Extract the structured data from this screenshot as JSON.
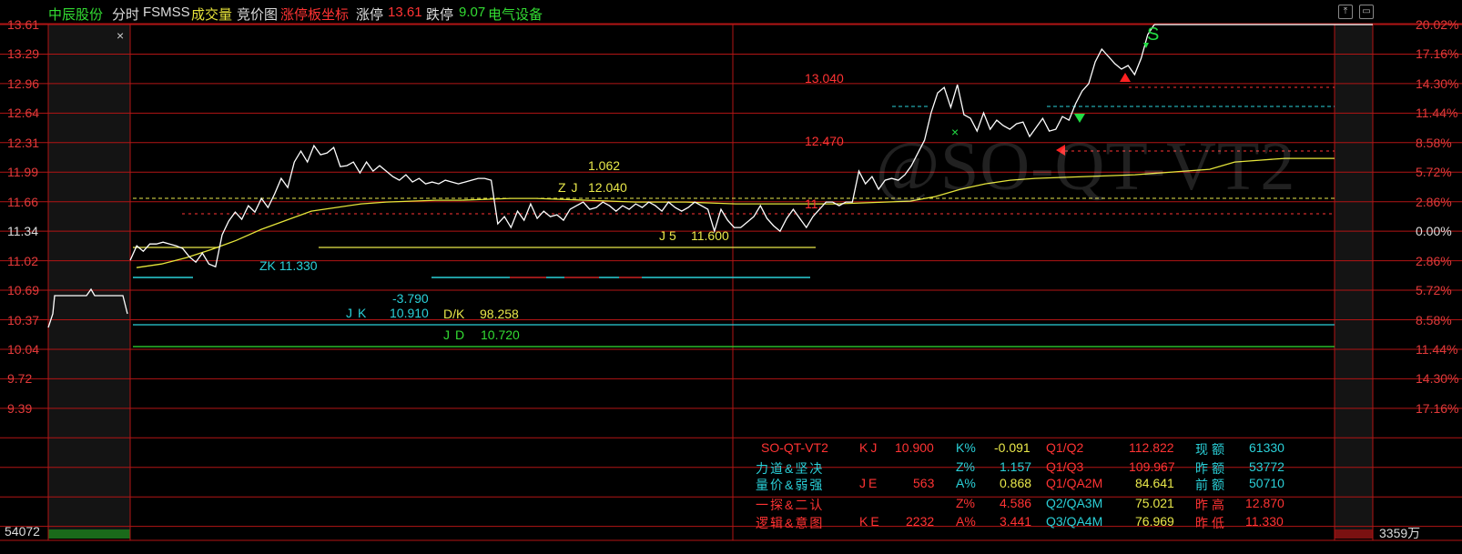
{
  "header": {
    "stock_name": "中辰股份",
    "mode": "分时",
    "indicator": "FSMSS",
    "volume_label": "成交量",
    "auction_label": "竞价图",
    "limit_coord_label": "涨停板坐标",
    "limit_up_label": "涨停",
    "limit_up_value": "13.61",
    "limit_down_label": "跌停",
    "limit_down_value": "9.07",
    "sector": "电气设备"
  },
  "colors": {
    "bg": "#000000",
    "grid": "#b21515",
    "up": "#ff3333",
    "down": "#22cc22",
    "price": "#ffffff",
    "avg": "#e5e53a",
    "cyan": "#2ad0d8",
    "yellow": "#e9e84a"
  },
  "axis": {
    "left": [
      "13.61",
      "13.29",
      "12.96",
      "12.64",
      "12.31",
      "11.99",
      "11.66",
      "11.34",
      "11.02",
      "10.69",
      "10.37",
      "10.04",
      "9.72",
      "9.39"
    ],
    "right": [
      "20.02%",
      "17.16%",
      "14.30%",
      "11.44%",
      "8.58%",
      "5.72%",
      "2.86%",
      "0.00%",
      "2.86%",
      "5.72%",
      "8.58%",
      "11.44%",
      "14.30%",
      "17.16%"
    ],
    "volume_left": "54072",
    "volume_right": "3359万"
  },
  "annotations": {
    "zk": "ZK 11.330",
    "jk_label": "JK",
    "jk_value": "10.910",
    "jk_delta": "-3.790",
    "dk": "D/K",
    "dk_value": "98.258",
    "jd": "JD",
    "jd_value": "10.720",
    "zj": "ZJ",
    "zj_value": "12.040",
    "zj_top": "1.062",
    "j5": "J5",
    "j5_value": "11.600",
    "p1": "13.040",
    "p2": "12.470",
    "p3": "11.",
    "s_mark": "S"
  },
  "watermark": "@SO-QT-VT2",
  "stats": {
    "r1": {
      "c1": "SO-QT-VT2",
      "c2": "KJ",
      "c3": "10.900",
      "c4": "K%",
      "c5": "-0.091",
      "c6": "Q1/Q2",
      "c7": "112.822",
      "c8": "现额",
      "c9": "61330"
    },
    "r2": {
      "c1": "力道&坚决",
      "c4": "Z%",
      "c5": "1.157",
      "c6": "Q1/Q3",
      "c7": "109.967",
      "c8": "昨额",
      "c9": "53772"
    },
    "r3": {
      "c1": "量价&弱强",
      "c2": "JE",
      "c3": "563",
      "c4": "A%",
      "c5": "0.868",
      "c6": "Q1/QA2M",
      "c7": "84.641",
      "c8": "前额",
      "c9": "50710"
    },
    "r4": {
      "c1": "一探&二认",
      "c4": "Z%",
      "c5": "4.586",
      "c6": "Q2/QA3M",
      "c7": "75.021",
      "c8": "昨高",
      "c9": "12.870"
    },
    "r5": {
      "c1": "逻辑&意图",
      "c2": "KE",
      "c3": "2232",
      "c4": "A%",
      "c5": "3.441",
      "c6": "Q3/QA4M",
      "c7": "76.969",
      "c8": "昨低",
      "c9": "11.330"
    }
  },
  "chart_data": {
    "type": "line",
    "ylim": [
      9.07,
      13.61
    ],
    "series": [
      {
        "values": [
          11.02,
          11.18,
          11.12,
          11.2,
          11.2,
          11.22,
          11.2,
          11.18,
          11.15,
          11.06,
          11.0,
          11.1,
          10.98,
          10.95,
          11.3,
          11.45,
          11.55,
          11.47,
          11.62,
          11.55,
          11.7,
          11.6,
          11.75,
          11.92,
          11.82,
          12.1,
          12.22,
          12.1,
          12.28,
          12.18,
          12.2,
          12.26,
          12.05,
          12.06,
          12.1,
          11.98,
          12.1,
          12.0,
          12.06,
          12.0,
          11.94,
          11.9,
          11.96,
          11.88,
          11.92,
          11.86,
          11.88,
          11.86,
          11.9,
          11.88,
          11.86,
          11.88,
          11.9,
          11.92,
          11.92,
          11.9,
          11.42,
          11.5,
          11.38,
          11.56,
          11.46,
          11.64,
          11.48,
          11.56,
          11.5,
          11.52,
          11.46,
          11.58,
          11.62,
          11.66,
          11.58,
          11.6,
          11.66,
          11.62,
          11.56,
          11.62,
          11.58,
          11.64,
          11.6,
          11.66,
          11.62,
          11.56,
          11.66,
          11.6,
          11.56,
          11.6,
          11.66,
          11.62,
          11.58,
          11.34,
          11.58,
          11.46,
          11.38,
          11.38,
          11.44,
          11.5,
          11.62,
          11.48,
          11.4,
          11.34,
          11.48,
          11.58,
          11.48,
          11.38,
          11.5,
          11.58,
          11.66,
          11.66,
          11.62,
          11.66,
          11.66,
          12.0,
          11.86,
          11.94,
          11.8,
          11.9,
          11.92,
          11.9,
          11.96,
          12.06,
          12.2,
          12.34,
          12.64,
          12.86,
          12.92,
          12.7,
          12.95,
          12.62,
          12.58,
          12.44,
          12.64,
          12.46,
          12.56,
          12.5,
          12.46,
          12.52,
          12.54,
          12.38,
          12.48,
          12.58,
          12.44,
          12.46,
          12.6,
          12.56,
          12.74,
          12.88,
          12.96,
          13.2,
          13.34,
          13.26,
          13.18,
          13.12,
          13.16,
          13.06,
          13.24,
          13.5,
          13.61
        ]
      },
      {
        "values": [
          10.94,
          10.98,
          11.05,
          11.14,
          11.24,
          11.36,
          11.46,
          11.56,
          11.6,
          11.64,
          11.66,
          11.67,
          11.68,
          11.68,
          11.69,
          11.7,
          11.7,
          11.69,
          11.68,
          11.67,
          11.66,
          11.66,
          11.66,
          11.65,
          11.64,
          11.64,
          11.64,
          11.64,
          11.64,
          11.65,
          11.66,
          11.67,
          11.72,
          11.8,
          11.86,
          11.9,
          11.92,
          11.93,
          11.94,
          11.95,
          11.96,
          11.98,
          12.0,
          12.02,
          12.1,
          12.12,
          12.14,
          12.14,
          12.14
        ]
      }
    ]
  }
}
